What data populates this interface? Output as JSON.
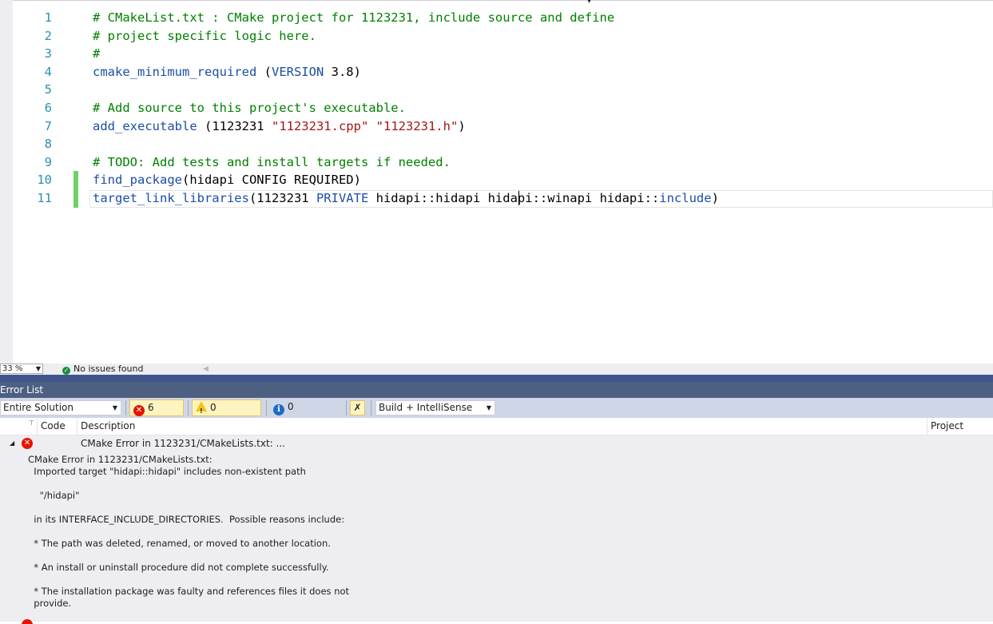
{
  "editor": {
    "lines": [
      {
        "num": "1",
        "segments": [
          {
            "t": "# CMakeList.txt : CMake project for 1123231, include source and define",
            "c": "cmt"
          }
        ]
      },
      {
        "num": "2",
        "segments": [
          {
            "t": "# project specific logic here.",
            "c": "cmt"
          }
        ]
      },
      {
        "num": "3",
        "segments": [
          {
            "t": "#",
            "c": "cmt"
          }
        ]
      },
      {
        "num": "4",
        "segments": [
          {
            "t": "cmake_minimum_required",
            "c": "fn"
          },
          {
            "t": " (",
            "c": ""
          },
          {
            "t": "VERSION",
            "c": "fn"
          },
          {
            "t": " 3.8)",
            "c": ""
          }
        ]
      },
      {
        "num": "5",
        "segments": []
      },
      {
        "num": "6",
        "segments": [
          {
            "t": "# Add source to this project's executable.",
            "c": "cmt"
          }
        ]
      },
      {
        "num": "7",
        "segments": [
          {
            "t": "add_executable",
            "c": "fn"
          },
          {
            "t": " (1123231 ",
            "c": ""
          },
          {
            "t": "\"1123231.cpp\"",
            "c": "str"
          },
          {
            "t": " ",
            "c": ""
          },
          {
            "t": "\"1123231.h\"",
            "c": "str"
          },
          {
            "t": ")",
            "c": ""
          }
        ]
      },
      {
        "num": "8",
        "segments": []
      },
      {
        "num": "9",
        "segments": [
          {
            "t": "# TODO: Add tests and install targets if needed.",
            "c": "cmt"
          }
        ]
      },
      {
        "num": "10",
        "segments": [
          {
            "t": "find_package",
            "c": "fn"
          },
          {
            "t": "(hidapi CONFIG REQUIRED)",
            "c": ""
          }
        ]
      },
      {
        "num": "11",
        "segments": [
          {
            "t": "target_link_libraries",
            "c": "fn"
          },
          {
            "t": "(1123231 ",
            "c": ""
          },
          {
            "t": "PRIVATE",
            "c": "fn"
          },
          {
            "t": " hidapi::hidapi hidapi::winapi hidapi::",
            "c": ""
          },
          {
            "t": "include",
            "c": "fn"
          },
          {
            "t": ")",
            "c": ""
          }
        ]
      }
    ],
    "changed_lines": [
      10,
      11
    ],
    "current_line": 11
  },
  "statusbar": {
    "zoom": "33 %",
    "issues_text": "No issues found",
    "issues_icon": "check-circle-icon"
  },
  "error_list": {
    "title": "Error List",
    "scope_value": "Entire Solution",
    "errors_label": "6 Errors",
    "warnings_label": "0 Warnings",
    "messages_label": "0 Messages",
    "build_filter_value": "Build + IntelliSense",
    "columns": {
      "code": "Code",
      "description": "Description",
      "project": "Project"
    },
    "rows": [
      {
        "description": "CMake Error in 1123231/CMakeLists.txt: ...",
        "detail": "CMake Error in 1123231/CMakeLists.txt:\n  Imported target \"hidapi::hidapi\" includes non-existent path\n\n    \"/hidapi\"\n\n  in its INTERFACE_INCLUDE_DIRECTORIES.  Possible reasons include:\n\n  * The path was deleted, renamed, or moved to another location.\n\n  * An install or uninstall procedure did not complete successfully.\n\n  * The installation package was faulty and references files it does not\n  provide."
      }
    ]
  },
  "colors": {
    "comment": "#008000",
    "function": "#1b4ea8",
    "string": "#a31515",
    "line_number": "#2b91af",
    "change_bar": "#6ed068",
    "error": "#e51400",
    "toolwindow_title": "#4d6082"
  }
}
